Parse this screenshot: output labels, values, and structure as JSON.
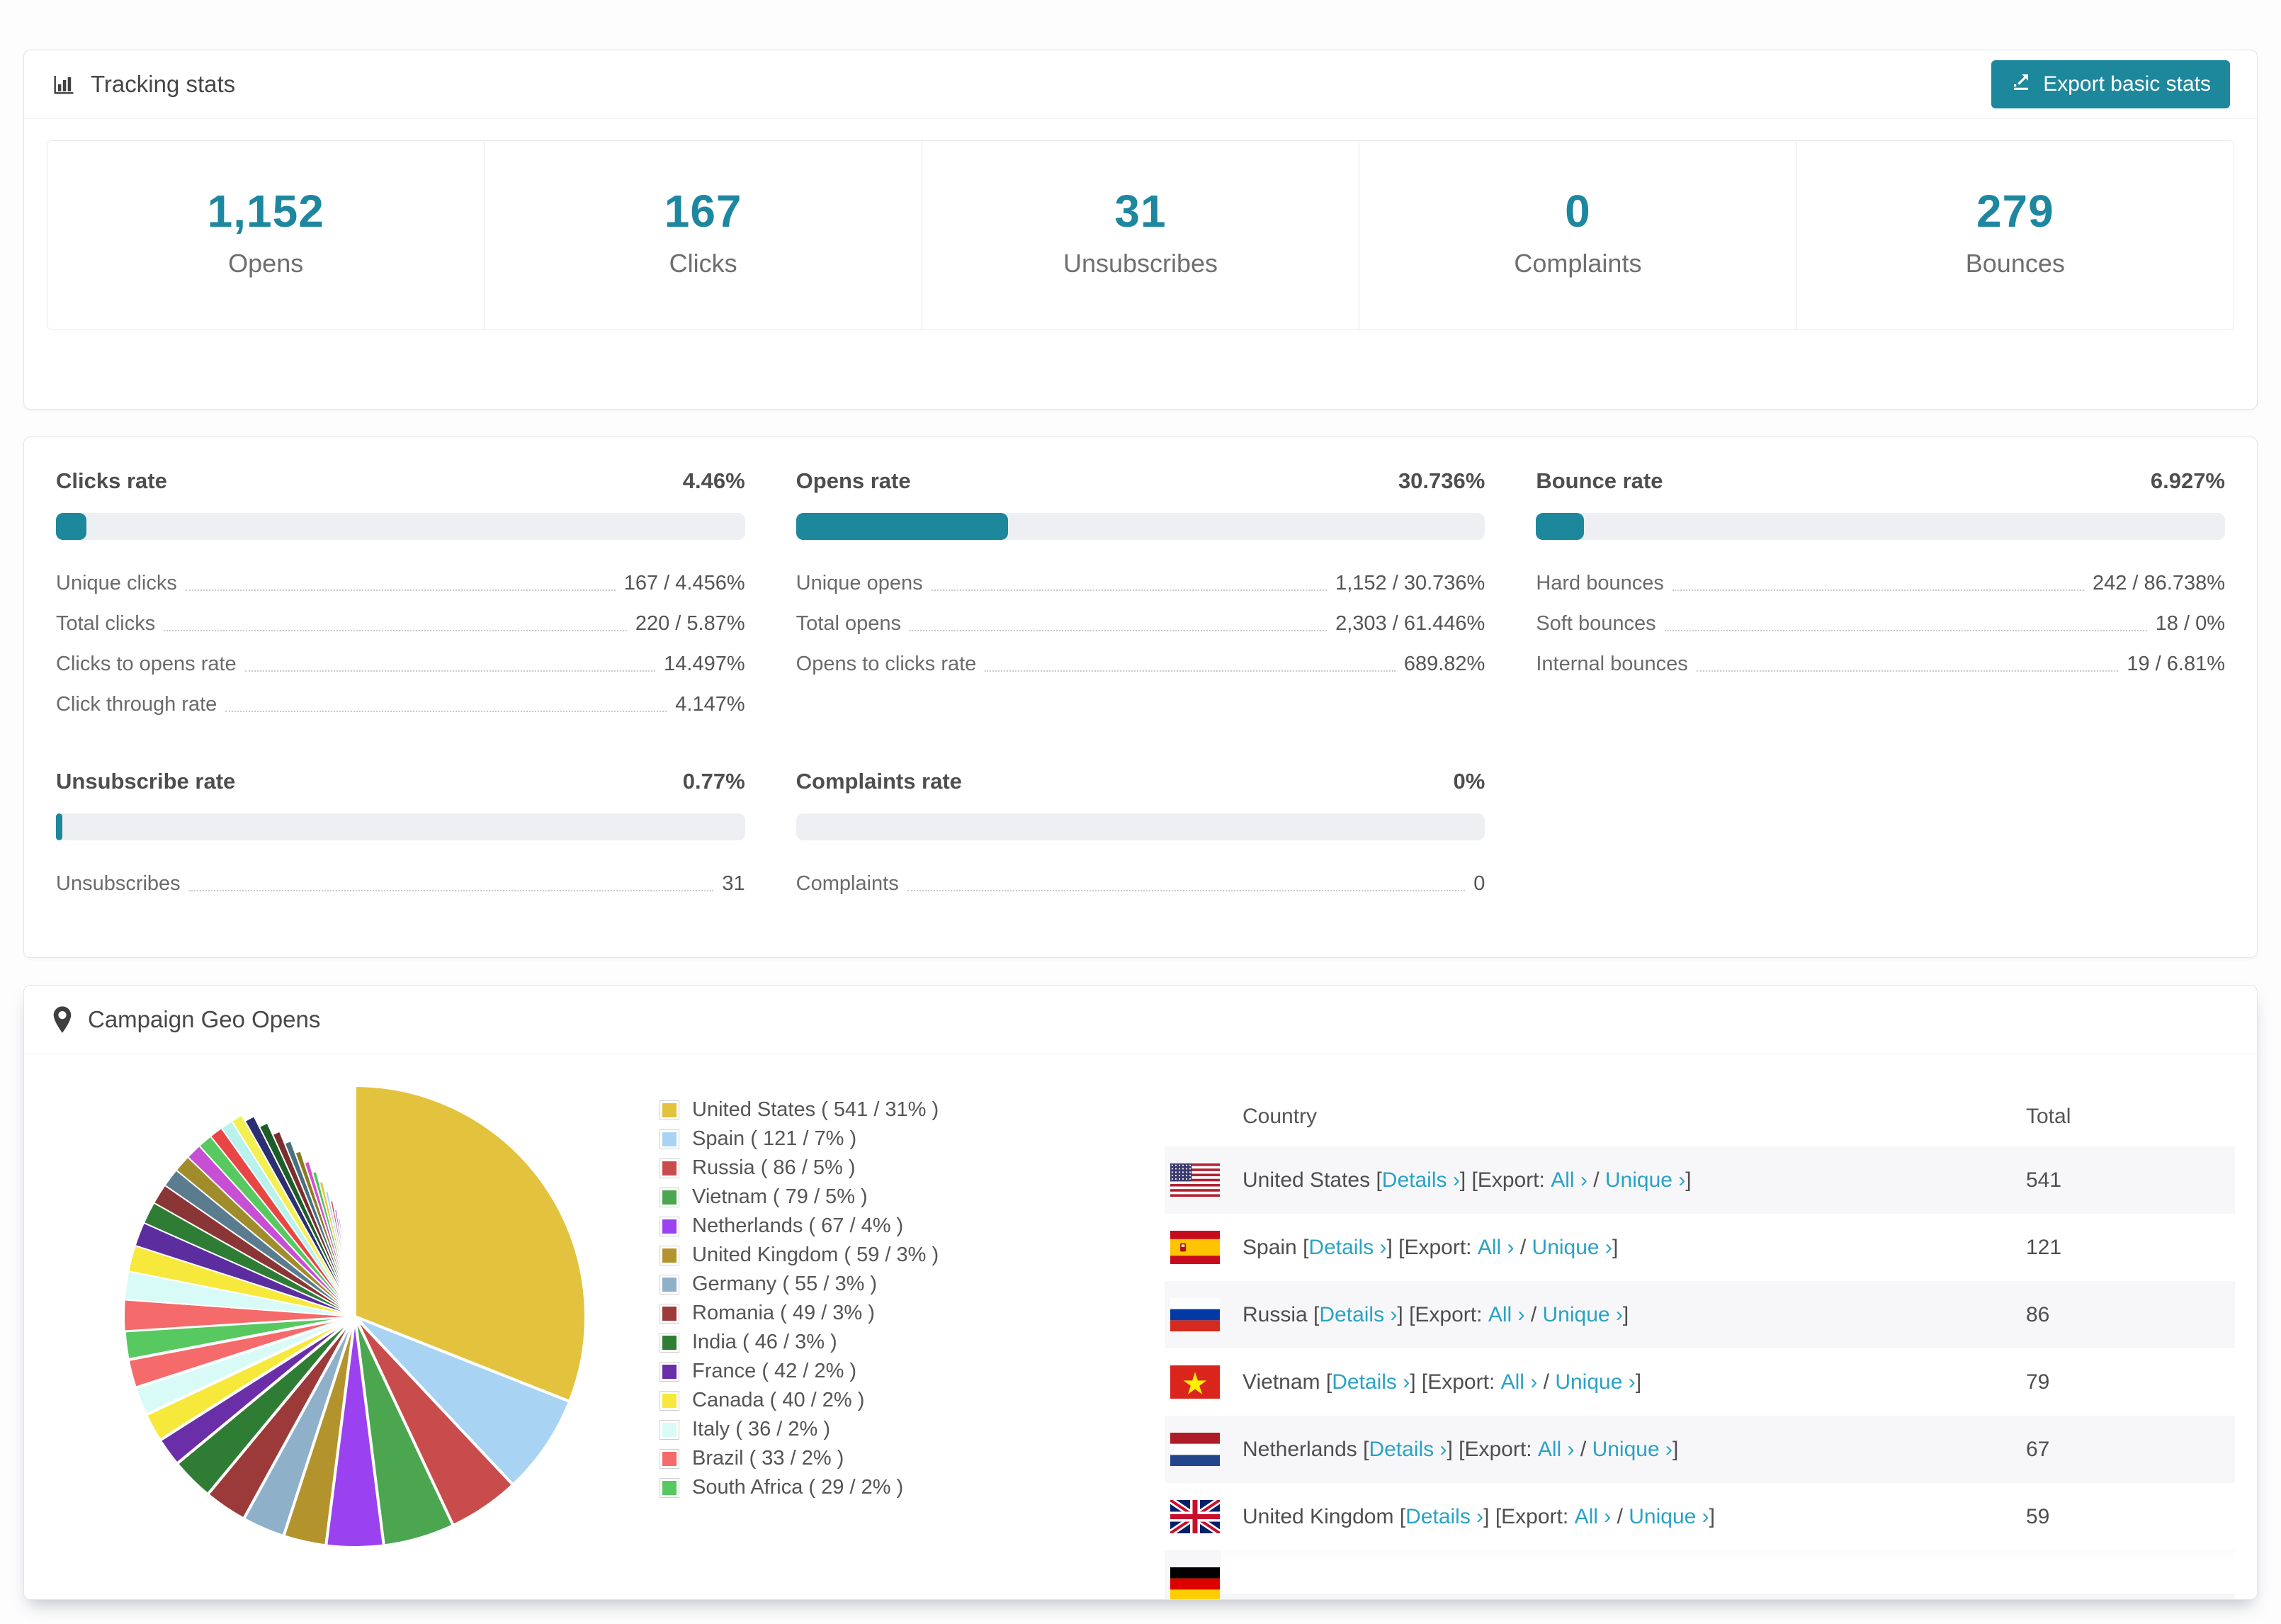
{
  "accent": "#1d879c",
  "link_color": "#2aa2c5",
  "header": {
    "title": "Tracking stats",
    "export_label": "Export basic stats"
  },
  "stats": [
    {
      "value": "1,152",
      "label": "Opens"
    },
    {
      "value": "167",
      "label": "Clicks"
    },
    {
      "value": "31",
      "label": "Unsubscribes"
    },
    {
      "value": "0",
      "label": "Complaints"
    },
    {
      "value": "279",
      "label": "Bounces"
    }
  ],
  "rates": [
    {
      "title": "Clicks rate",
      "pct_label": "4.46%",
      "pct": 4.46,
      "rows": [
        {
          "label": "Unique clicks",
          "value": "167 / 4.456%"
        },
        {
          "label": "Total clicks",
          "value": "220 / 5.87%"
        },
        {
          "label": "Clicks to opens rate",
          "value": "14.497%"
        },
        {
          "label": "Click through rate",
          "value": "4.147%"
        }
      ]
    },
    {
      "title": "Opens rate",
      "pct_label": "30.736%",
      "pct": 30.736,
      "rows": [
        {
          "label": "Unique opens",
          "value": "1,152 / 30.736%"
        },
        {
          "label": "Total opens",
          "value": "2,303 / 61.446%"
        },
        {
          "label": "Opens to clicks rate",
          "value": "689.82%"
        }
      ]
    },
    {
      "title": "Bounce rate",
      "pct_label": "6.927%",
      "pct": 6.927,
      "rows": [
        {
          "label": "Hard bounces",
          "value": "242 / 86.738%"
        },
        {
          "label": "Soft bounces",
          "value": "18 / 0%"
        },
        {
          "label": "Internal bounces",
          "value": "19 / 6.81%"
        }
      ]
    },
    {
      "title": "Unsubscribe rate",
      "pct_label": "0.77%",
      "pct": 0.77,
      "rows": [
        {
          "label": "Unsubscribes",
          "value": "31"
        }
      ]
    },
    {
      "title": "Complaints rate",
      "pct_label": "0%",
      "pct": 0,
      "rows": [
        {
          "label": "Complaints",
          "value": "0"
        }
      ]
    }
  ],
  "geo": {
    "title": "Campaign Geo Opens",
    "table": {
      "columns": {
        "country": "Country",
        "total": "Total"
      },
      "links": {
        "details": "Details ›",
        "export_prefix": "Export:",
        "all": "All ›",
        "unique": "Unique ›"
      },
      "rows": [
        {
          "flag": "us",
          "country": "United States",
          "total": "541"
        },
        {
          "flag": "es",
          "country": "Spain",
          "total": "121"
        },
        {
          "flag": "ru",
          "country": "Russia",
          "total": "86"
        },
        {
          "flag": "vn",
          "country": "Vietnam",
          "total": "79"
        },
        {
          "flag": "nl",
          "country": "Netherlands",
          "total": "67"
        },
        {
          "flag": "gb",
          "country": "United Kingdom",
          "total": "59"
        },
        {
          "flag": "de",
          "country": "",
          "total": "",
          "partial": true
        }
      ]
    }
  },
  "chart_data": {
    "type": "pie",
    "title": "Campaign Geo Opens",
    "legend_position": "right",
    "items": [
      {
        "label": "United States",
        "count": 541,
        "pct": 31,
        "color": "#e3c23e"
      },
      {
        "label": "Spain",
        "count": 121,
        "pct": 7,
        "color": "#a9d3f2"
      },
      {
        "label": "Russia",
        "count": 86,
        "pct": 5,
        "color": "#c94c4c"
      },
      {
        "label": "Vietnam",
        "count": 79,
        "pct": 5,
        "color": "#4ba64f"
      },
      {
        "label": "Netherlands",
        "count": 67,
        "pct": 4,
        "color": "#9a41f0"
      },
      {
        "label": "United Kingdom",
        "count": 59,
        "pct": 3,
        "color": "#b3932c"
      },
      {
        "label": "Germany",
        "count": 55,
        "pct": 3,
        "color": "#8fb0c9"
      },
      {
        "label": "Romania",
        "count": 49,
        "pct": 3,
        "color": "#9c3a3a"
      },
      {
        "label": "India",
        "count": 46,
        "pct": 3,
        "color": "#2f7d35"
      },
      {
        "label": "France",
        "count": 42,
        "pct": 2,
        "color": "#6a2fa8"
      },
      {
        "label": "Canada",
        "count": 40,
        "pct": 2,
        "color": "#f6e93c"
      },
      {
        "label": "Italy",
        "count": 36,
        "pct": 2,
        "color": "#d9fbf7"
      },
      {
        "label": "Brazil",
        "count": 33,
        "pct": 2,
        "color": "#f56a6a"
      },
      {
        "label": "South Africa",
        "count": 29,
        "pct": 2,
        "color": "#58c860"
      }
    ],
    "other_unlabeled_pct_total": 26
  }
}
